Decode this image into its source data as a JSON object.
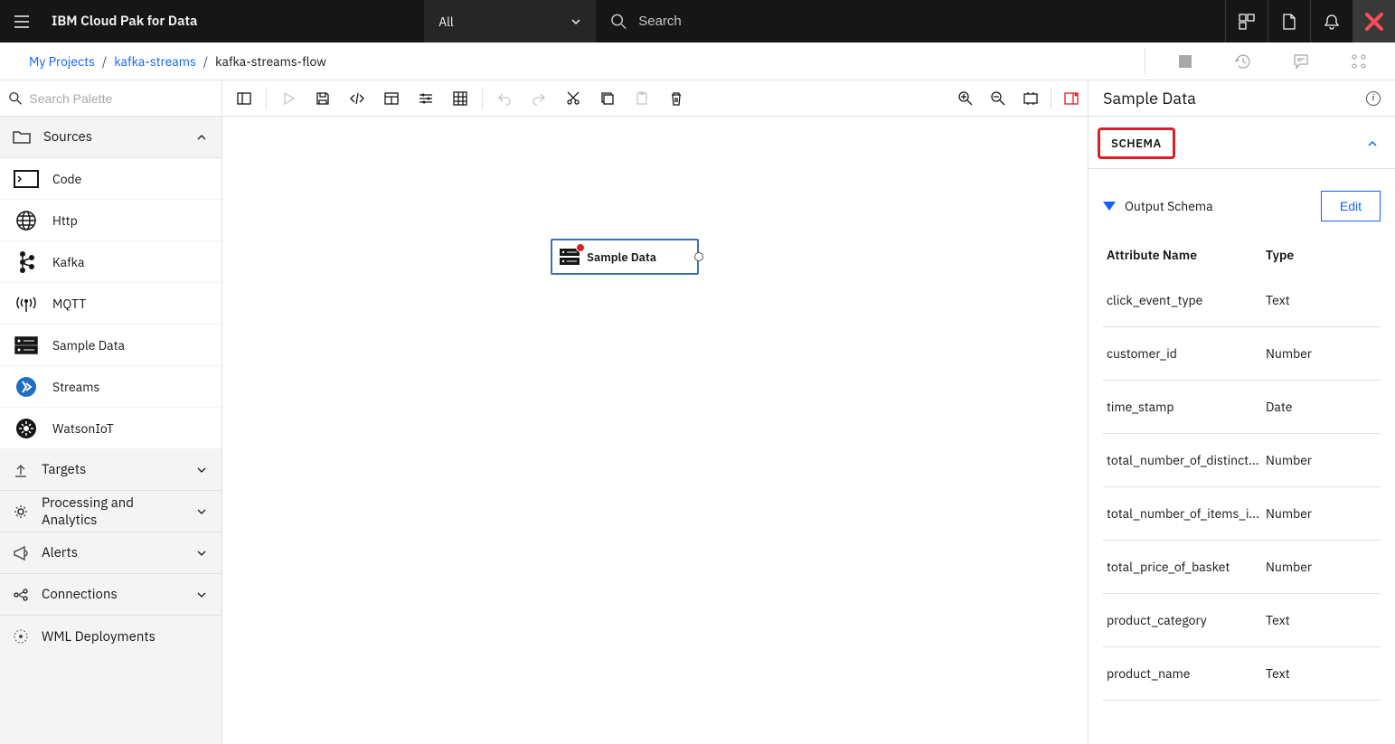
{
  "header": {
    "title": "IBM Cloud Pak for Data",
    "dropdown_label": "All",
    "search_placeholder": "Search"
  },
  "breadcrumbs": {
    "root": "My Projects",
    "project": "kafka-streams",
    "current": "kafka-streams-flow"
  },
  "palette": {
    "search_placeholder": "Search Palette",
    "sections": {
      "sources_label": "Sources",
      "targets_label": "Targets",
      "processing_label": "Processing and Analytics",
      "alerts_label": "Alerts",
      "connections_label": "Connections",
      "wml_label": "WML Deployments"
    },
    "source_items": [
      "Code",
      "Http",
      "Kafka",
      "MQTT",
      "Sample Data",
      "Streams",
      "WatsonIoT"
    ]
  },
  "canvas": {
    "node_label": "Sample Data"
  },
  "right_panel": {
    "title": "Sample Data",
    "schema_header": "SCHEMA",
    "output_schema_label": "Output Schema",
    "edit_label": "Edit",
    "col_name_header": "Attribute Name",
    "col_type_header": "Type",
    "rows": [
      {
        "name": "click_event_type",
        "type": "Text"
      },
      {
        "name": "customer_id",
        "type": "Number"
      },
      {
        "name": "time_stamp",
        "type": "Date"
      },
      {
        "name": "total_number_of_distinct...",
        "type": "Number"
      },
      {
        "name": "total_number_of_items_i...",
        "type": "Number"
      },
      {
        "name": "total_price_of_basket",
        "type": "Number"
      },
      {
        "name": "product_category",
        "type": "Text"
      },
      {
        "name": "product_name",
        "type": "Text"
      }
    ]
  }
}
